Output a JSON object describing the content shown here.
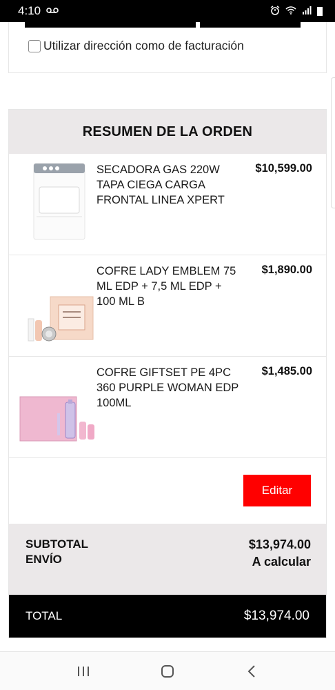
{
  "status_bar": {
    "time": "4:10",
    "voicemail_icon": "voicemail-icon",
    "alarm_icon": "alarm-icon",
    "wifi_icon": "wifi-icon",
    "signal_icon": "signal-icon",
    "battery_icon": "battery-icon"
  },
  "billing": {
    "checkbox_label": "Utilizar dirección como de facturación",
    "checked": false
  },
  "summary": {
    "title": "RESUMEN DE LA ORDEN",
    "items": [
      {
        "name": "SECADORA GAS 220W TAPA CIEGA CARGA FRONTAL LINEA XPERT",
        "price": "$10,599.00",
        "image": "dryer-image"
      },
      {
        "name": "COFRE LADY EMBLEM 75 ML EDP + 7,5 ML EDP + 100 ML B",
        "price": "$1,890.00",
        "image": "perfume-gift-set-image"
      },
      {
        "name": "COFRE GIFTSET PE 4PC 360 PURPLE WOMAN EDP 100ML",
        "price": "$1,485.00",
        "image": "perfume-gift-set-image"
      }
    ],
    "edit_label": "Editar",
    "subtotal_label": "SUBTOTAL",
    "subtotal_value": "$13,974.00",
    "shipping_label": "ENVÍO",
    "shipping_value": "A calcular",
    "total_label": "TOTAL",
    "total_value": "$13,974.00"
  },
  "colors": {
    "accent": "#ff0000",
    "header_bg": "#ebe8e9",
    "total_bg": "#000000"
  },
  "nav_bar": {
    "recents_icon": "recents-icon",
    "home_icon": "home-icon",
    "back_icon": "back-icon"
  }
}
